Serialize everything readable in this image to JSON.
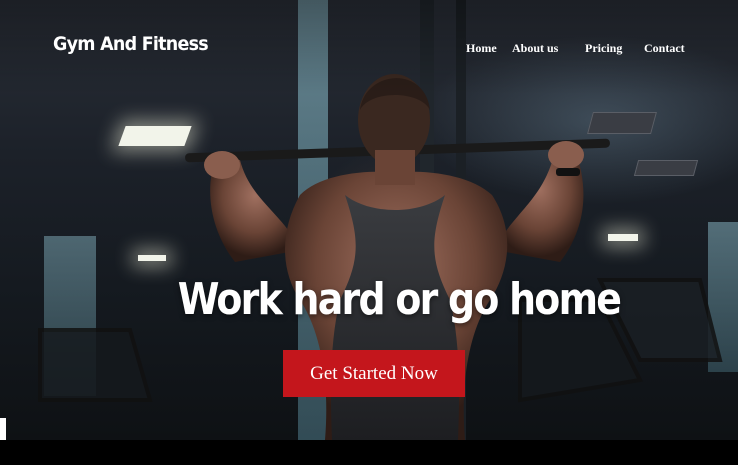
{
  "brand": {
    "name": "Gym And Fitness"
  },
  "nav": {
    "items": [
      {
        "label": "Home"
      },
      {
        "label": "About us"
      },
      {
        "label": "Pricing"
      },
      {
        "label": "Contact"
      }
    ]
  },
  "hero": {
    "headline": "Work hard or go home",
    "cta_label": "Get Started Now",
    "image_icon": "gym-athlete-photo"
  },
  "colors": {
    "cta": "#c4161c",
    "text": "#ffffff",
    "background": "#000000"
  }
}
